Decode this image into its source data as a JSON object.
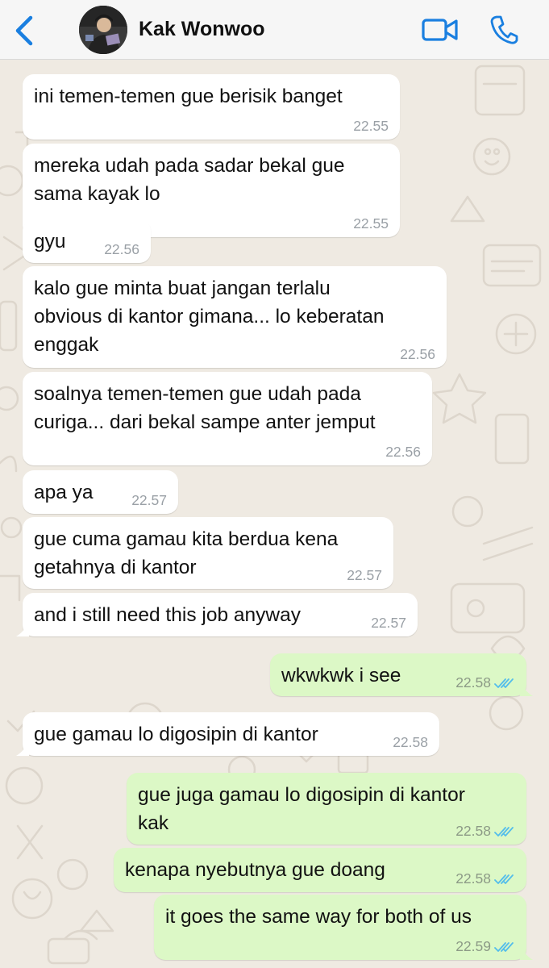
{
  "header": {
    "contact_name": "Kak Wonwoo"
  },
  "messages": [
    {
      "id": 1,
      "direction": "in",
      "text": "ini temen-temen gue berisik banget",
      "time": "22.55"
    },
    {
      "id": 2,
      "direction": "in",
      "text": "mereka udah pada sadar bekal gue\nsama kayak lo",
      "time": "22.55"
    },
    {
      "id": 3,
      "direction": "in",
      "text": "gyu",
      "time": "22.56"
    },
    {
      "id": 4,
      "direction": "in",
      "text": "kalo gue minta buat jangan terlalu\nobvious di kantor gimana... lo keberatan\nenggak",
      "time": "22.56"
    },
    {
      "id": 5,
      "direction": "in",
      "text": "soalnya temen-temen gue udah pada\ncuriga... dari bekal sampe anter jemput",
      "time": "22.56"
    },
    {
      "id": 6,
      "direction": "in",
      "text": "apa ya",
      "time": "22.57"
    },
    {
      "id": 7,
      "direction": "in",
      "text": "gue cuma gamau kita berdua kena\ngetahnya di kantor",
      "time": "22.57"
    },
    {
      "id": 8,
      "direction": "in",
      "text": "and i still need this job anyway",
      "time": "22.57"
    },
    {
      "id": 9,
      "direction": "out",
      "text": "wkwkwk i see",
      "time": "22.58"
    },
    {
      "id": 10,
      "direction": "in",
      "text": "gue gamau lo digosipin di kantor",
      "time": "22.58"
    },
    {
      "id": 11,
      "direction": "out",
      "text": "gue juga gamau lo digosipin di kantor\nkak",
      "time": "22.58"
    },
    {
      "id": 12,
      "direction": "out",
      "text": "kenapa nyebutnya gue doang",
      "time": "22.58"
    },
    {
      "id": 13,
      "direction": "out",
      "text": "it goes the same way for both of us",
      "time": "22.59"
    }
  ],
  "colors": {
    "accent": "#1a7fe0",
    "incoming_bubble": "#ffffff",
    "outgoing_bubble": "#dcf8c6",
    "read_tick": "#53bdeb"
  },
  "icons": {
    "back": "chevron-left-icon",
    "video": "video-camera-icon",
    "call": "phone-icon",
    "read_receipt": "double-check-icon"
  }
}
